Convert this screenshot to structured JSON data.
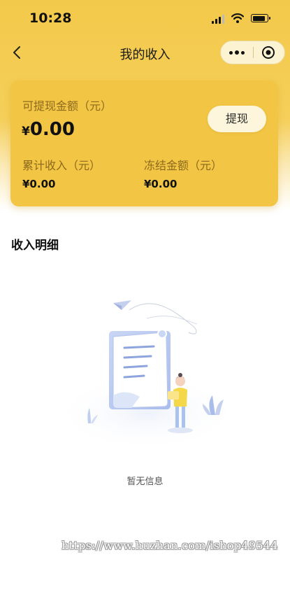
{
  "status_bar": {
    "time": "10:28"
  },
  "nav": {
    "title": "我的收入",
    "back_icon": "chevron-left-icon",
    "more_icon": "more-dots-icon",
    "close_icon": "target-circle-icon"
  },
  "card": {
    "withdrawable_label": "可提现金额（元）",
    "currency_symbol": "¥",
    "withdrawable_amount": "0.00",
    "withdraw_button": "提现",
    "total_income_label": "累计收入（元）",
    "total_income_value": "¥0.00",
    "frozen_label": "冻结金额（元）",
    "frozen_value": "¥0.00"
  },
  "section": {
    "title": "收入明细"
  },
  "empty_state": {
    "illustration": "empty-document-illustration",
    "text": "暂无信息"
  },
  "watermark": {
    "text": "https://www.huzhan.com/ishop49544"
  },
  "colors": {
    "header_yellow": "#f3c94a",
    "card_yellow": "#f2c544",
    "label_brown": "#8d6a1d",
    "button_cream": "#fdf6dc"
  }
}
